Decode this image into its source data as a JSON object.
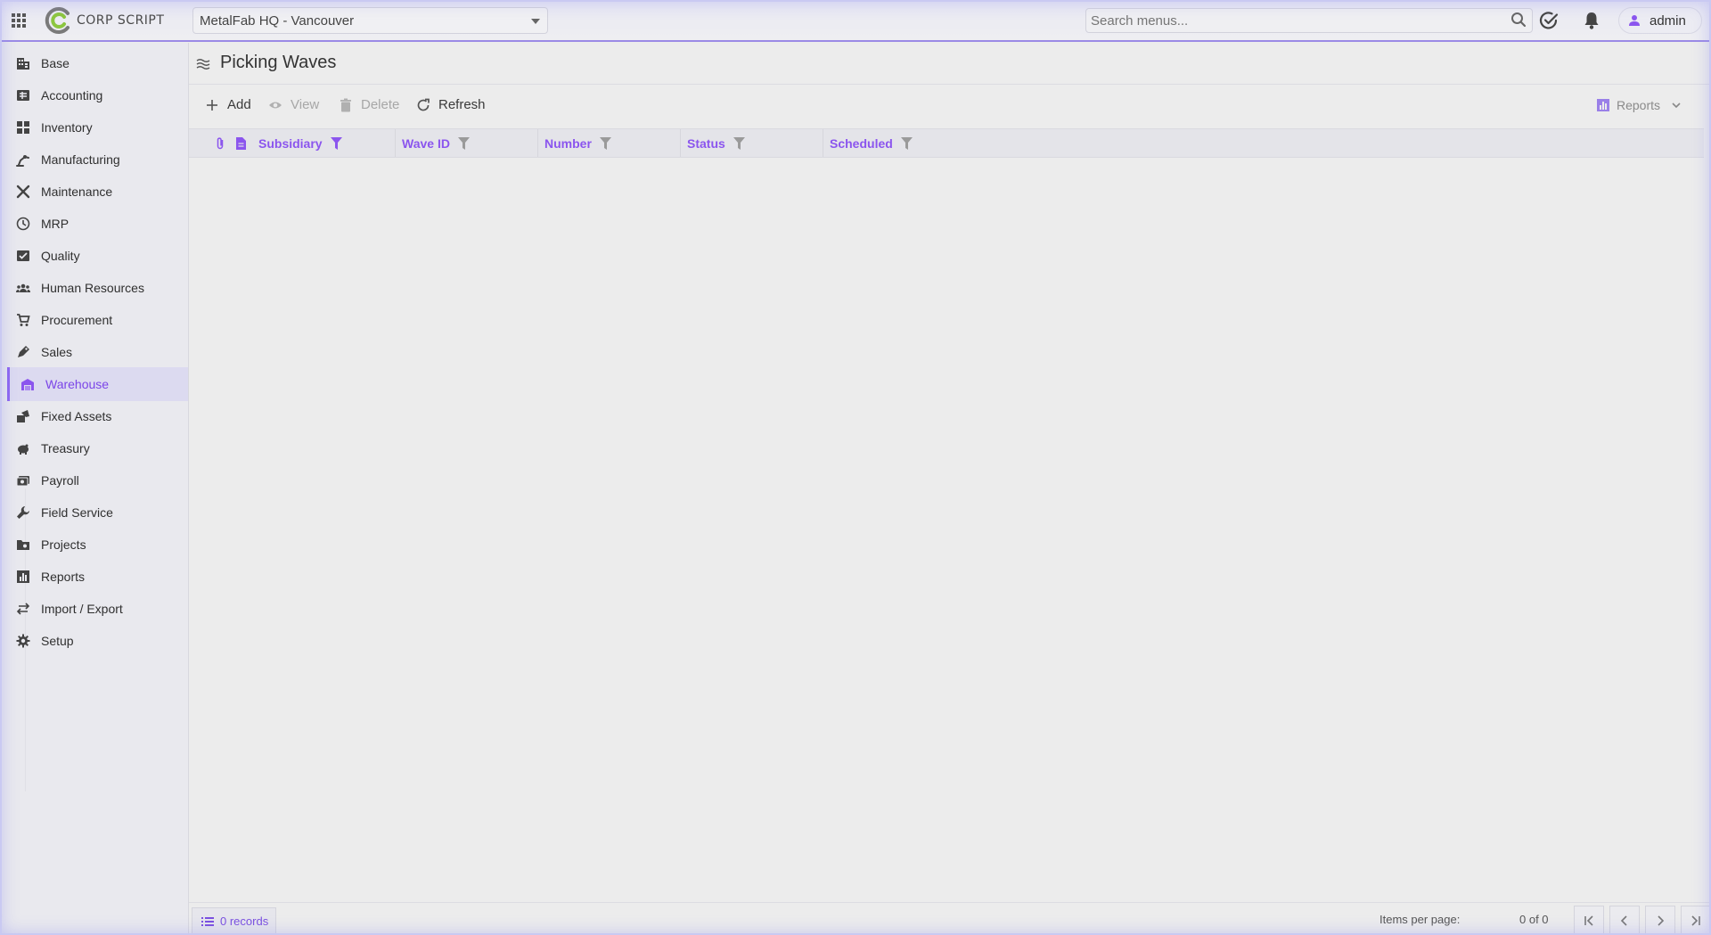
{
  "header": {
    "logo_text": "CORP SCRIPT",
    "subsidiary": "MetalFab HQ - Vancouver",
    "search_placeholder": "Search menus...",
    "user": "admin"
  },
  "sidebar": {
    "items": [
      {
        "label": "Base",
        "icon": "building-icon"
      },
      {
        "label": "Accounting",
        "icon": "ledger-icon"
      },
      {
        "label": "Inventory",
        "icon": "boxes-icon"
      },
      {
        "label": "Manufacturing",
        "icon": "robot-arm-icon"
      },
      {
        "label": "Maintenance",
        "icon": "tools-icon"
      },
      {
        "label": "MRP",
        "icon": "clock-icon"
      },
      {
        "label": "Quality",
        "icon": "checklist-icon"
      },
      {
        "label": "Human Resources",
        "icon": "people-icon"
      },
      {
        "label": "Procurement",
        "icon": "cart-icon"
      },
      {
        "label": "Sales",
        "icon": "tag-icon"
      },
      {
        "label": "Warehouse",
        "icon": "warehouse-icon",
        "active": true
      },
      {
        "label": "Fixed Assets",
        "icon": "assets-icon"
      },
      {
        "label": "Treasury",
        "icon": "piggy-bank-icon"
      },
      {
        "label": "Payroll",
        "icon": "payroll-icon"
      },
      {
        "label": "Field Service",
        "icon": "wrench-icon"
      },
      {
        "label": "Projects",
        "icon": "folder-icon"
      },
      {
        "label": "Reports",
        "icon": "bar-chart-icon"
      },
      {
        "label": "Import / Export",
        "icon": "arrows-icon"
      },
      {
        "label": "Setup",
        "icon": "gear-icon"
      }
    ]
  },
  "page": {
    "title": "Picking Waves"
  },
  "toolbar": {
    "add": "Add",
    "view": "View",
    "delete": "Delete",
    "refresh": "Refresh",
    "reports": "Reports"
  },
  "grid": {
    "columns": [
      "Subsidiary",
      "Wave ID",
      "Number",
      "Status",
      "Scheduled"
    ]
  },
  "footer": {
    "records": "0 records",
    "items_per_page": "Items per page:",
    "range": "0 of 0"
  },
  "colors": {
    "accent": "#8b55ee",
    "header_border": "#9b8ae6"
  }
}
